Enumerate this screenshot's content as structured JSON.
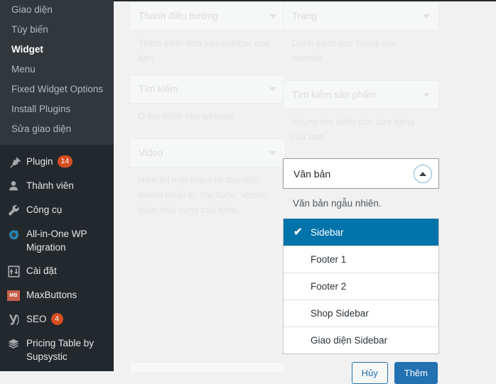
{
  "sidebar": {
    "submenu": [
      {
        "label": "Giao diện",
        "current": false
      },
      {
        "label": "Tùy biến",
        "current": false
      },
      {
        "label": "Widget",
        "current": true
      },
      {
        "label": "Menu",
        "current": false
      },
      {
        "label": "Fixed Widget Options",
        "current": false
      },
      {
        "label": "Install Plugins",
        "current": false
      },
      {
        "label": "Sửa giao diện",
        "current": false
      }
    ],
    "menu": [
      {
        "label": "Plugin",
        "icon": "plug-icon",
        "badge": "14"
      },
      {
        "label": "Thành viên",
        "icon": "user-icon",
        "badge": ""
      },
      {
        "label": "Công cụ",
        "icon": "wrench-icon",
        "badge": ""
      },
      {
        "label": "All-in-One WP Migration",
        "icon": "refresh-circle-icon",
        "badge": ""
      },
      {
        "label": "Cài đặt",
        "icon": "settings-sliders-icon",
        "badge": ""
      },
      {
        "label": "MaxButtons",
        "icon": "maxbuttons-mb-icon",
        "badge": ""
      },
      {
        "label": "SEO",
        "icon": "yoast-y-icon",
        "badge": "4"
      },
      {
        "label": "Pricing Table by Supsystic",
        "icon": "stack-layers-icon",
        "badge": ""
      }
    ],
    "badge_color": "#d54e21"
  },
  "widgets": {
    "left_column": [
      {
        "title": "Thanh điều hướng",
        "description": "Thêm trình đơn vào sidebar của bạn."
      },
      {
        "title": "Tìm kiếm",
        "description": "Ô tìm kiếm cho website"
      },
      {
        "title": "Video",
        "description": "Hiển thị một video từ thư viện media hoặc từ YouTube, Vimeo, hoặc nhà cung cấp khác."
      }
    ],
    "right_column": [
      {
        "title": "Trang",
        "description": "Danh sách các Trang của website"
      },
      {
        "title": "Tìm kiếm sản phẩm",
        "description": "Khung tìm kiếm cho cửa hàng của bạn."
      }
    ]
  },
  "active_widget": {
    "title": "Văn bản",
    "description": "Văn bản ngẫu nhiên.",
    "collapse_icon": "chevron-up-icon",
    "selected_option": "Sidebar",
    "check_glyph": "✔",
    "options": [
      {
        "label": "Sidebar",
        "selected": true
      },
      {
        "label": "Footer 1",
        "selected": false
      },
      {
        "label": "Footer 2",
        "selected": false
      },
      {
        "label": "Shop Sidebar",
        "selected": false
      },
      {
        "label": "Giao diện Sidebar",
        "selected": false
      }
    ],
    "cancel_label": "Hủy",
    "add_label": "Thêm",
    "accent_color": "#0073aa",
    "button_color": "#2271b1"
  }
}
